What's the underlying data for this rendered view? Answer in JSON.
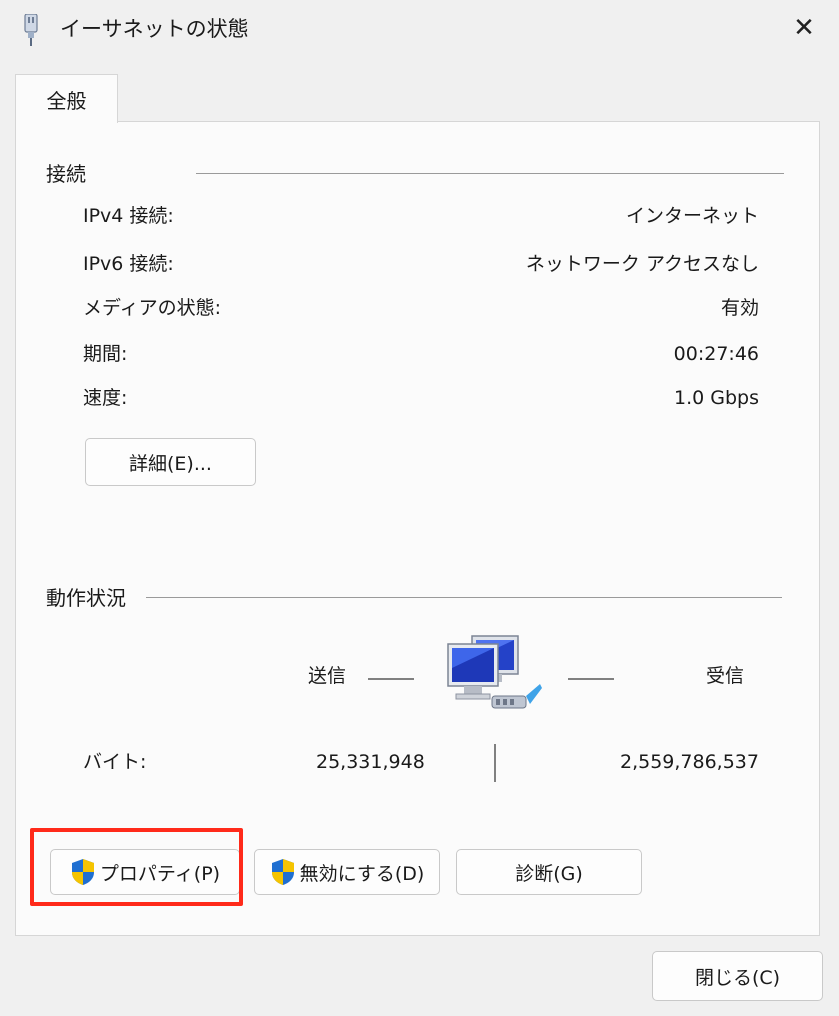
{
  "window": {
    "title": "イーサネットの状態",
    "close_glyph": "✕"
  },
  "tab": {
    "label": "全般"
  },
  "connection": {
    "heading": "接続",
    "rows": [
      {
        "label": "IPv4 接続:",
        "value": "インターネット"
      },
      {
        "label": "IPv6 接続:",
        "value": "ネットワーク アクセスなし"
      },
      {
        "label": "メディアの状態:",
        "value": "有効"
      },
      {
        "label": "期間:",
        "value": "00:27:46"
      },
      {
        "label": "速度:",
        "value": "1.0 Gbps"
      }
    ],
    "details_button": "詳細(E)..."
  },
  "activity": {
    "heading": "動作状況",
    "sent_label": "送信",
    "received_label": "受信",
    "bytes_label": "バイト:",
    "bytes_sent": "25,331,948",
    "bytes_received": "2,559,786,537"
  },
  "buttons": {
    "properties": "プロパティ(P)",
    "disable": "無効にする(D)",
    "diagnose": "診断(G)",
    "close": "閉じる(C)"
  },
  "icons": {
    "title": "ethernet-cable-icon",
    "network": "network-computers-icon",
    "shield": "uac-shield-icon"
  },
  "colors": {
    "highlight": "#ff2a1a",
    "shield_blue": "#1f6fd1",
    "shield_yellow": "#f5c400"
  }
}
